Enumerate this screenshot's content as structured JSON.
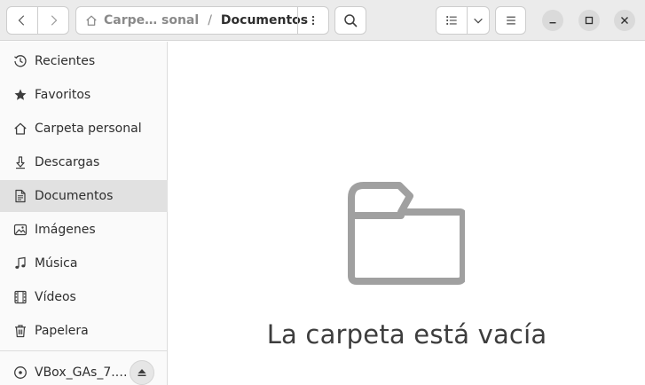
{
  "header": {
    "path": {
      "parent_label": "Carpe… sonal",
      "separator": "/",
      "current_label": "Documentos"
    }
  },
  "sidebar": {
    "items": [
      {
        "label": "Recientes",
        "icon": "clock-icon"
      },
      {
        "label": "Favoritos",
        "icon": "star-icon"
      },
      {
        "label": "Carpeta personal",
        "icon": "home-icon"
      },
      {
        "label": "Descargas",
        "icon": "download-icon"
      },
      {
        "label": "Documentos",
        "icon": "document-icon",
        "selected": true
      },
      {
        "label": "Imágenes",
        "icon": "image-icon"
      },
      {
        "label": "Música",
        "icon": "music-icon"
      },
      {
        "label": "Vídeos",
        "icon": "video-icon"
      },
      {
        "label": "Papelera",
        "icon": "trash-icon"
      }
    ],
    "devices": [
      {
        "label": "VBox_GAs_7.…",
        "icon": "disc-icon",
        "action_icon": "eject-icon"
      }
    ]
  },
  "main": {
    "empty_message": "La carpeta está vacía",
    "empty_icon": "folder-icon"
  },
  "colors": {
    "header_bg": "#ebebeb",
    "sidebar_bg": "#fafafa",
    "selected_bg": "#e1e1e1",
    "folder_stroke": "#a0a0a0"
  }
}
